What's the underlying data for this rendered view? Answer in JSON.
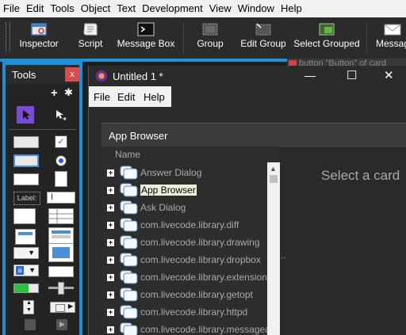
{
  "menubar": {
    "items": [
      "File",
      "Edit",
      "Tools",
      "Object",
      "Text",
      "Development",
      "View",
      "Window",
      "Help"
    ]
  },
  "toolbar": {
    "buttons": [
      {
        "label": "Inspector"
      },
      {
        "label": "Script"
      },
      {
        "label": "Message Box"
      },
      {
        "label": "Group"
      },
      {
        "label": "Edit Group"
      },
      {
        "label": "Select Grouped"
      },
      {
        "label": "Messag"
      }
    ]
  },
  "background_hint": "button \"Button\" of card",
  "tools_palette": {
    "title": "Tools",
    "close": "x",
    "label_tool": "Label:"
  },
  "window": {
    "title": "Untitled 1 *",
    "menu": [
      "File",
      "Edit",
      "Help"
    ],
    "controls": {
      "minimize": "—",
      "maximize": "☐",
      "close": "✕"
    }
  },
  "app_browser": {
    "title": "App Browser",
    "column": "Name",
    "items": [
      "Answer Dialog",
      "App Browser",
      "Ask Dialog",
      "com.livecode.library.diff",
      "com.livecode.library.drawing",
      "com.livecode.library.dropbox",
      "com.livecode.library.extension-u",
      "com.livecode.library.getopt",
      "com.livecode.library.httpd",
      "com.livecode.library.messageau"
    ],
    "selected_index": 1,
    "placeholder": "Select a card"
  },
  "colors": {
    "accent": "#1e90d8",
    "close": "#d94c4c",
    "selected_bg": "#f0f0d8"
  }
}
